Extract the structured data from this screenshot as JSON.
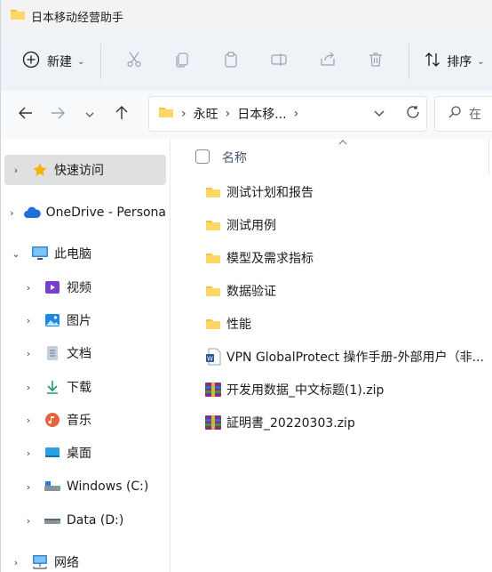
{
  "window": {
    "title": "日本移动经营助手"
  },
  "toolbar": {
    "new_label": "新建",
    "sort_label": "排序"
  },
  "breadcrumb": [
    "永旺",
    "日本移..."
  ],
  "search": {
    "placeholder": "在"
  },
  "navpane": {
    "items": [
      {
        "label": "快速访问",
        "icon": "star-icon"
      },
      {
        "label": "OneDrive - Persona",
        "icon": "cloud-icon"
      },
      {
        "label": "此电脑",
        "icon": "monitor-icon"
      },
      {
        "label": "视频",
        "icon": "video-icon"
      },
      {
        "label": "图片",
        "icon": "picture-icon"
      },
      {
        "label": "文档",
        "icon": "document-icon"
      },
      {
        "label": "下载",
        "icon": "download-icon"
      },
      {
        "label": "音乐",
        "icon": "music-icon"
      },
      {
        "label": "桌面",
        "icon": "desktop-icon"
      },
      {
        "label": "Windows (C:)",
        "icon": "drive-icon"
      },
      {
        "label": "Data (D:)",
        "icon": "drive-icon"
      },
      {
        "label": "网络",
        "icon": "network-icon"
      }
    ]
  },
  "content": {
    "column_name": "名称",
    "files": [
      {
        "name": "测试计划和报告",
        "type": "folder"
      },
      {
        "name": "测试用例",
        "type": "folder"
      },
      {
        "name": "模型及需求指标",
        "type": "folder"
      },
      {
        "name": "数据验证",
        "type": "folder"
      },
      {
        "name": "性能",
        "type": "folder"
      },
      {
        "name": "VPN GlobalProtect 操作手册-外部用户（非...",
        "type": "word"
      },
      {
        "name": "开发用数据_中文标题(1).zip",
        "type": "zip"
      },
      {
        "name": "証明書_20220303.zip",
        "type": "zip"
      }
    ]
  }
}
